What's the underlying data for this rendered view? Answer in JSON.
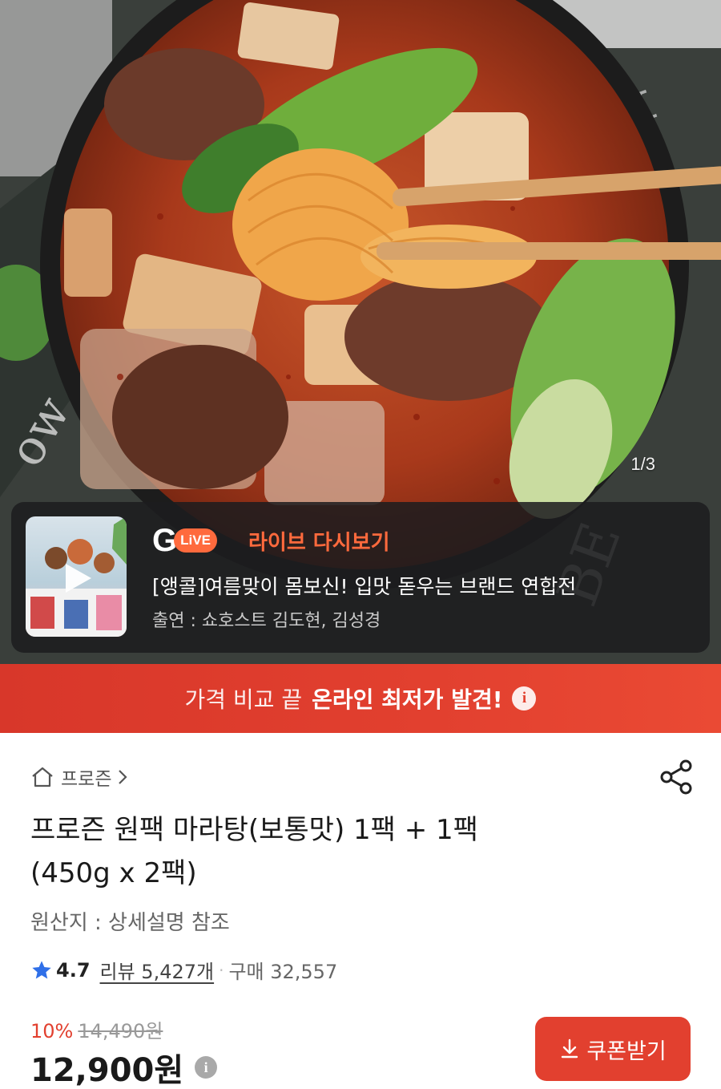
{
  "gallery": {
    "counter": "1/3"
  },
  "live": {
    "logo_g": "G",
    "logo_live": "LiVE",
    "title": "라이브 다시보기",
    "description": "[앵콜]여름맞이 몸보신! 입맛 돋우는 브랜드 연합전",
    "cast": "출연 : 쇼호스트 김도현, 김성경"
  },
  "price_banner": {
    "light_text": "가격 비교 끝",
    "bold_text": "온라인 최저가 발견!",
    "info_icon": "i"
  },
  "product": {
    "category": "프로즌",
    "title_line1": "프로즌 원팩 마라탕(보통맛) 1팩 + 1팩",
    "title_line2": "(450g x 2팩)",
    "origin": "원산지 : 상세설명 참조",
    "rating": "4.7",
    "reviews": "리뷰 5,427개",
    "separator": "·",
    "purchases": "구매 32,557",
    "discount_rate": "10%",
    "original_price": "14,490원",
    "price": "12,900원",
    "price_info_icon": "i",
    "coupon_label": "쿠폰받기"
  },
  "colors": {
    "accent": "#e2402f",
    "live_orange": "#ff6a3d",
    "star": "#2f6fe8"
  }
}
